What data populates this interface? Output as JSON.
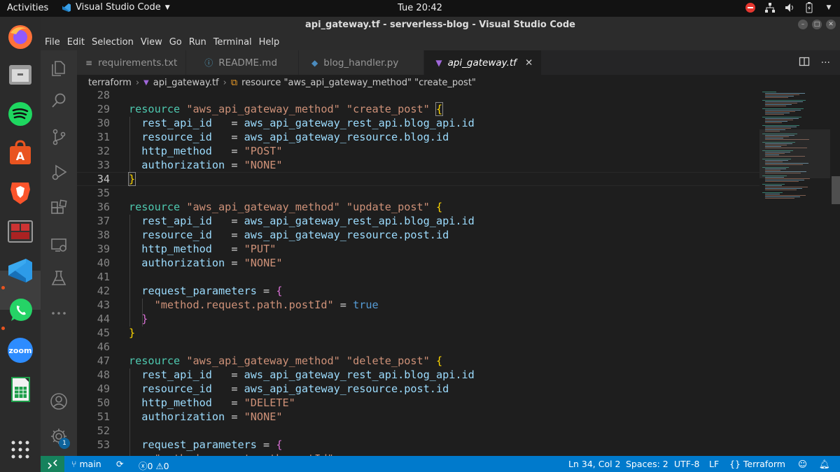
{
  "topbar": {
    "activities": "Activities",
    "app_name": "Visual Studio Code",
    "clock": "Tue 20:42"
  },
  "window": {
    "title": "api_gateway.tf - serverless-blog - Visual Studio Code"
  },
  "menu": [
    "File",
    "Edit",
    "Selection",
    "View",
    "Go",
    "Run",
    "Terminal",
    "Help"
  ],
  "tabs": [
    {
      "label": "requirements.txt",
      "icon": "lines-icon"
    },
    {
      "label": "README.md",
      "icon": "info-icon"
    },
    {
      "label": "blog_handler.py",
      "icon": "python-icon"
    },
    {
      "label": "api_gateway.tf",
      "icon": "terraform-icon",
      "active": true
    }
  ],
  "breadcrumb": {
    "folder": "terraform",
    "file": "api_gateway.tf",
    "symbol": "resource \"aws_api_gateway_method\" \"create_post\""
  },
  "activity_badge": "1",
  "editor": {
    "line_numbers": [
      "28",
      "29",
      "30",
      "31",
      "32",
      "33",
      "34",
      "35",
      "36",
      "37",
      "38",
      "39",
      "40",
      "41",
      "42",
      "43",
      "44",
      "45",
      "46",
      "47",
      "48",
      "49",
      "50",
      "51",
      "52",
      "53"
    ],
    "current_line": "34",
    "tokens": {
      "resource": "resource",
      "method_type": "\"aws_api_gateway_method\"",
      "create_post": "\"create_post\"",
      "update_post": "\"update_post\"",
      "delete_post": "\"delete_post\"",
      "open_brace": "{",
      "close_brace": "}",
      "rest_api_id": "rest_api_id",
      "resource_id": "resource_id",
      "http_method": "http_method",
      "authorization": "authorization",
      "request_parameters": "request_parameters",
      "eq": "=",
      "rest_api_ref": "aws_api_gateway_rest_api.blog_api.id",
      "blog_resource_ref": "aws_api_gateway_resource.blog.id",
      "post_resource_ref": "aws_api_gateway_resource.post.id",
      "post": "\"POST\"",
      "put": "\"PUT\"",
      "delete": "\"DELETE\"",
      "none": "\"NONE\"",
      "path_param": "\"method.request.path.postId\"",
      "true": "true"
    }
  },
  "status": {
    "branch": "main",
    "problems": "0",
    "warnings": "0",
    "position": "Ln 34, Col 2",
    "spaces": "Spaces: 2",
    "encoding": "UTF-8",
    "eol": "LF",
    "language": "Terraform"
  },
  "colors": {
    "statusbar": "#007acc",
    "remote": "#16825d",
    "keyword": "#4ec9b0",
    "string": "#ce9178",
    "attribute": "#9cdcfe"
  }
}
